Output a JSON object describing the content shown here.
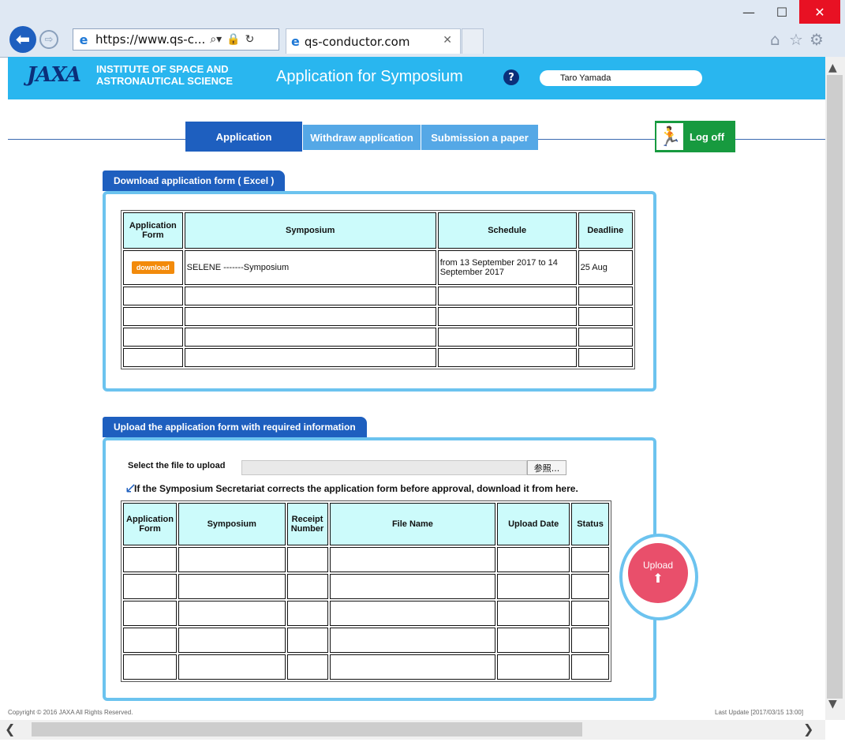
{
  "browser": {
    "address": "https://www.qs-c...",
    "tab_title": "qs-conductor.com",
    "minimize": "—",
    "maximize": "☐",
    "close": "✕",
    "back": "⬅",
    "forward": "⇨",
    "icons": [
      "home-icon",
      "star-icon",
      "gear-icon"
    ]
  },
  "header": {
    "logo": "JAXA",
    "institute_line1": "INSTITUTE OF SPACE AND",
    "institute_line2": "ASTRONAUTICAL SCIENCE",
    "title": "Application for Symposium",
    "help": "?",
    "user": "Taro Yamada"
  },
  "nav": {
    "tabs": [
      "Application",
      "Withdraw application",
      "Submission a paper"
    ],
    "logoff": "Log off"
  },
  "download_section": {
    "label": "Download application form ( Excel )",
    "headers": [
      "Application Form",
      "Symposium",
      "Schedule",
      "Deadline"
    ],
    "rows": [
      {
        "button": "download",
        "symposium": "SELENE -------Symposium",
        "schedule": "from 13 September 2017 to 14 September 2017",
        "deadline": "25 Aug"
      },
      {
        "button": "",
        "symposium": "",
        "schedule": "",
        "deadline": ""
      },
      {
        "button": "",
        "symposium": "",
        "schedule": "",
        "deadline": ""
      },
      {
        "button": "",
        "symposium": "",
        "schedule": "",
        "deadline": ""
      },
      {
        "button": "",
        "symposium": "",
        "schedule": "",
        "deadline": ""
      }
    ]
  },
  "upload_section": {
    "label": "Upload the application form with required information",
    "file_label": "Select the file to upload",
    "browse": "参照...",
    "note": "If the Symposium Secretariat corrects the application form before approval, download it from here.",
    "headers": [
      "Application Form",
      "Symposium",
      "Receipt Number",
      "File Name",
      "Upload Date",
      "Status"
    ],
    "row_count": 5,
    "upload_button": "Upload"
  },
  "footer": {
    "copyright": "Copyright © 2016 JAXA All Rights Reserved.",
    "last_update": "Last Update [2017/03/15 13:00]"
  }
}
